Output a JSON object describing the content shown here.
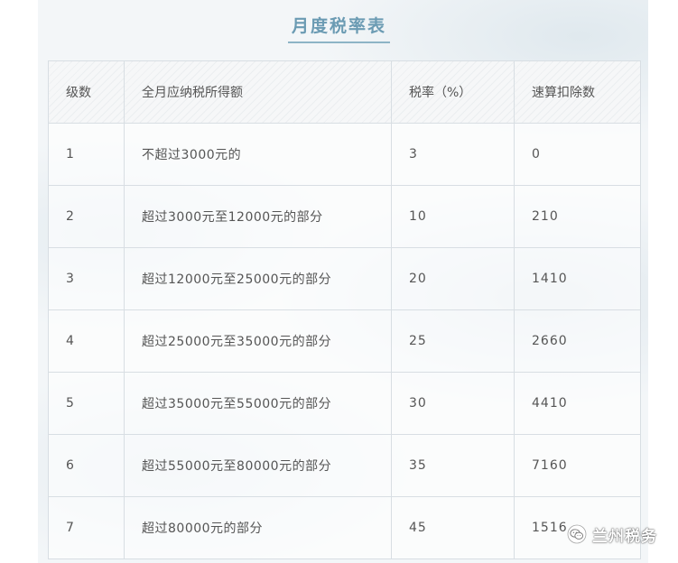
{
  "title": "月度税率表",
  "table": {
    "headers": [
      "级数",
      "全月应纳税所得额",
      "税率（%）",
      "速算扣除数"
    ],
    "rows": [
      {
        "level": "1",
        "range": "不超过3000元的",
        "rate": "3",
        "deduction": "0"
      },
      {
        "level": "2",
        "range": "超过3000元至12000元的部分",
        "rate": "10",
        "deduction": "210"
      },
      {
        "level": "3",
        "range": "超过12000元至25000元的部分",
        "rate": "20",
        "deduction": "1410"
      },
      {
        "level": "4",
        "range": "超过25000元至35000元的部分",
        "rate": "25",
        "deduction": "2660"
      },
      {
        "level": "5",
        "range": "超过35000元至55000元的部分",
        "rate": "30",
        "deduction": "4410"
      },
      {
        "level": "6",
        "range": "超过55000元至80000元的部分",
        "rate": "35",
        "deduction": "7160"
      },
      {
        "level": "7",
        "range": "超过80000元的部分",
        "rate": "45",
        "deduction": "1516"
      }
    ]
  },
  "watermark": {
    "text": "兰州税务",
    "icon": "wechat-icon"
  }
}
